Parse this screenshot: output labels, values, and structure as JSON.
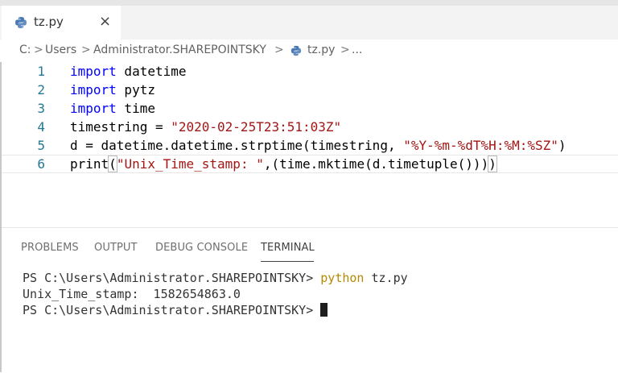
{
  "tab": {
    "filename": "tz.py",
    "close_symbol": "×"
  },
  "breadcrumb": {
    "items": [
      "C:",
      "Users",
      "Administrator.SHAREPOINTSKY",
      "tz.py",
      "..."
    ],
    "separator": ">"
  },
  "editor": {
    "lines": [
      {
        "number": "1",
        "tokens": [
          [
            "kw",
            "import"
          ],
          [
            "plain",
            " datetime"
          ]
        ]
      },
      {
        "number": "2",
        "tokens": [
          [
            "kw",
            "import"
          ],
          [
            "plain",
            " pytz"
          ]
        ]
      },
      {
        "number": "3",
        "tokens": [
          [
            "kw",
            "import"
          ],
          [
            "plain",
            " time"
          ]
        ]
      },
      {
        "number": "4",
        "tokens": [
          [
            "plain",
            "timestring = "
          ],
          [
            "str",
            "\"2020-02-25T23:51:03Z\""
          ]
        ]
      },
      {
        "number": "5",
        "tokens": [
          [
            "plain",
            "d = datetime.datetime.strptime(timestring, "
          ],
          [
            "str",
            "\"%Y-%m-%dT%H:%M:%SZ\""
          ],
          [
            "plain",
            ")"
          ]
        ]
      },
      {
        "number": "6",
        "tokens": [
          [
            "plain",
            "print"
          ],
          [
            "bracket",
            "("
          ],
          [
            "str",
            "\"Unix_Time_stamp: \""
          ],
          [
            "plain",
            ",(time.mktime(d.timetuple()))"
          ],
          [
            "bracket",
            ")"
          ]
        ]
      }
    ],
    "current_line": "6"
  },
  "panel": {
    "tabs": [
      "PROBLEMS",
      "OUTPUT",
      "DEBUG CONSOLE",
      "TERMINAL"
    ],
    "active_tab": "TERMINAL"
  },
  "terminal": {
    "line1_prompt": "PS C:\\Users\\Administrator.SHAREPOINTSKY> ",
    "line1_command": "python",
    "line1_args": " tz.py",
    "line2_output": "Unix_Time_stamp:  1582654863.0",
    "line3_prompt": "PS C:\\Users\\Administrator.SHAREPOINTSKY> "
  },
  "colors": {
    "keyword": "#0000ff",
    "string": "#a31515",
    "line_number": "#237893",
    "terminal_command": "#b58900"
  },
  "icons": {
    "file_type": "python-icon",
    "close": "close-icon"
  }
}
